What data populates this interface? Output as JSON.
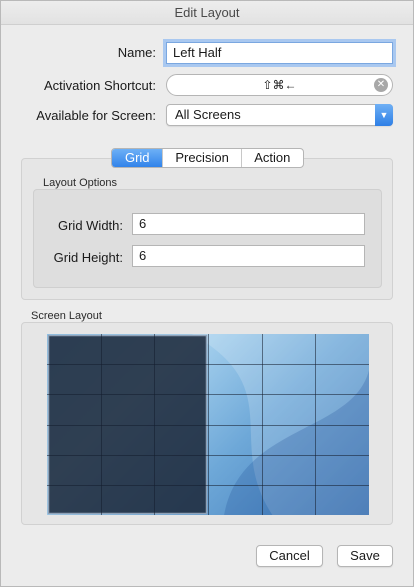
{
  "window": {
    "title": "Edit Layout"
  },
  "form": {
    "name_label": "Name:",
    "name_value": "Left Half",
    "shortcut_label": "Activation Shortcut:",
    "shortcut_value": "⇧⌘←",
    "screen_label": "Available for Screen:",
    "screen_value": "All Screens"
  },
  "tabs": [
    {
      "label": "Grid",
      "selected": true
    },
    {
      "label": "Precision",
      "selected": false
    },
    {
      "label": "Action",
      "selected": false
    }
  ],
  "layout_options": {
    "title": "Layout Options",
    "grid_width_label": "Grid Width:",
    "grid_width_value": "6",
    "grid_height_label": "Grid Height:",
    "grid_height_value": "6"
  },
  "screen_layout": {
    "title": "Screen Layout",
    "grid_columns": 6,
    "grid_rows": 6,
    "selected_columns": 3,
    "selected_rows": 6,
    "selection_color": "#1e2a3c",
    "accent_color": "#3183ea"
  },
  "buttons": {
    "cancel": "Cancel",
    "save": "Save"
  }
}
